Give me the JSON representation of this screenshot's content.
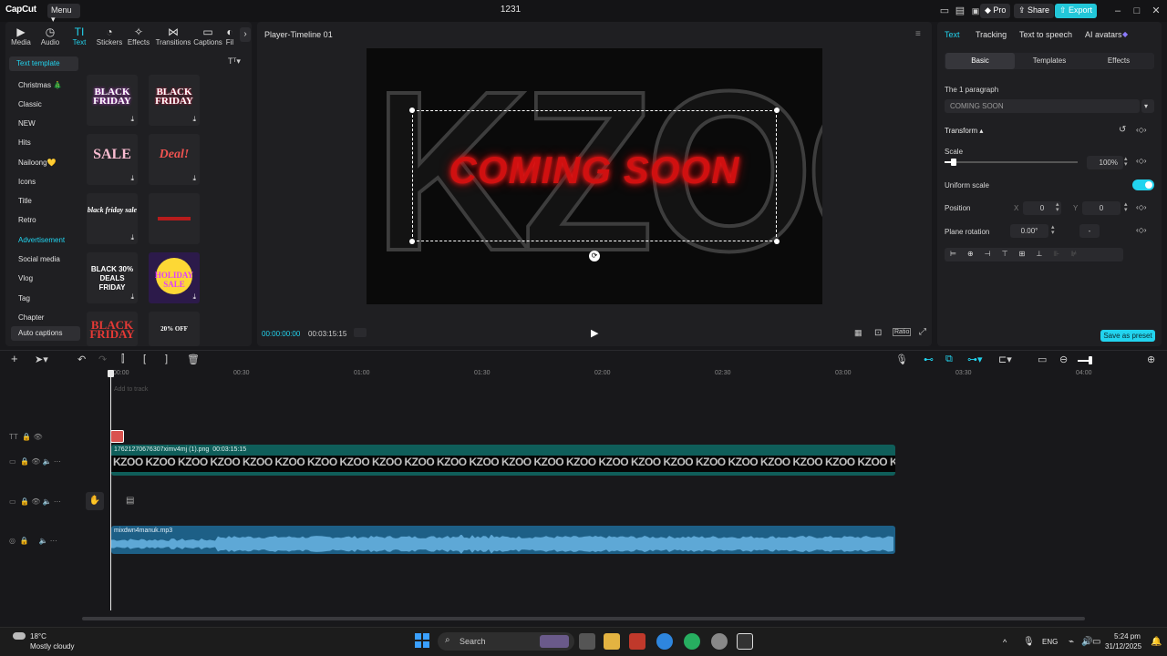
{
  "app": {
    "logo": "CapCut",
    "menu": "Menu",
    "project_title": "1231",
    "pro": "Pro",
    "share": "Share",
    "export": "Export"
  },
  "toolbar_tabs": [
    "Media",
    "Audio",
    "Text",
    "Stickers",
    "Effects",
    "Transitions",
    "Captions",
    "Fil"
  ],
  "text_panel": {
    "section": "Text template",
    "categories": [
      "Christmas 🎄",
      "Classic",
      "NEW",
      "Hits",
      "Nailoong💛",
      "Icons",
      "Title",
      "Retro",
      "Advertisement",
      "Social media",
      "Vlog",
      "Tag",
      "Chapter",
      "Auto captions"
    ],
    "thumbnails": [
      "BLACK FRIDAY",
      "BLACK FRIDAY",
      "SALE",
      "Deal!",
      "black friday sale",
      "",
      "BLACK 30% DEALS FRIDAY",
      "HOLIDAY SALE",
      "BLACK FRIDAY",
      "20% OFF"
    ]
  },
  "player": {
    "title": "Player-Timeline 01",
    "background_text": "KZOO",
    "overlay_text": "COMING SOON",
    "current_time": "00:00:00:00",
    "total_time": "00:03:15:15",
    "ratio": "Ratio"
  },
  "right_panel": {
    "tabs": [
      "Text",
      "Tracking",
      "Text to speech",
      "AI avatars"
    ],
    "subtabs": [
      "Basic",
      "Templates",
      "Effects"
    ],
    "paragraph_label": "The 1 paragraph",
    "paragraph_value": "COMING SOON",
    "transform": "Transform",
    "scale_label": "Scale",
    "scale_value": "100%",
    "scale_fraction": 0.07,
    "uniform_scale": "Uniform scale",
    "position_label": "Position",
    "pos_x_label": "X",
    "pos_x": "0",
    "pos_y_label": "Y",
    "pos_y": "0",
    "rotation_label": "Plane rotation",
    "rotation_value": "0.00°",
    "rotation_extra": "-",
    "save_preset": "Save as preset"
  },
  "timeline": {
    "ticks": [
      "00:00",
      "00:30",
      "01:00",
      "01:30",
      "02:00",
      "02:30",
      "03:00",
      "03:30",
      "04:00"
    ],
    "add_to_track": "Add to track",
    "video_clip": {
      "name": "17621270676307ximv4mj (1).png",
      "duration": "00:03:15:15",
      "frame_text": "KZOO"
    },
    "audio_clip": {
      "name": "mixdwn4manuk.mp3"
    }
  },
  "taskbar": {
    "weather_temp": "18°C",
    "weather_desc": "Mostly cloudy",
    "search": "Search",
    "lang": "ENG",
    "time": "5:24 pm",
    "date": "31/12/2025"
  }
}
